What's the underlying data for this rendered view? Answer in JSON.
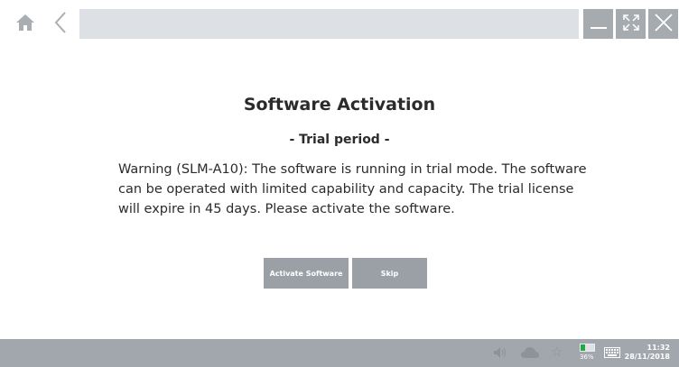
{
  "topbar": {
    "address_value": ""
  },
  "dialog": {
    "title": "Software Activation",
    "subtitle": "- Trial period -",
    "message": "Warning (SLM-A10): The software is running in trial mode. The software can be operated with limited capability and capacity. The trial license will expire in 45 days. Please activate the software.",
    "activate_label": "Activate Software",
    "skip_label": "Skip"
  },
  "taskbar": {
    "battery_percent": "36%",
    "battery_level": 0.36,
    "time": "11:32",
    "date": "28/11/2018"
  },
  "icons": {
    "home": "home-icon",
    "back": "chevron-left-icon",
    "minimize": "minimize-icon",
    "maximize": "maximize-icon",
    "close": "close-icon",
    "sound": "sound-icon",
    "cloud": "cloud-icon",
    "star": "star-icon",
    "keyboard": "keyboard-icon"
  },
  "colors": {
    "button_bg": "#9aa0a6",
    "taskbar_bg": "#a2a7ad",
    "address_bg": "#dde1e5",
    "battery_green": "#22a844"
  }
}
